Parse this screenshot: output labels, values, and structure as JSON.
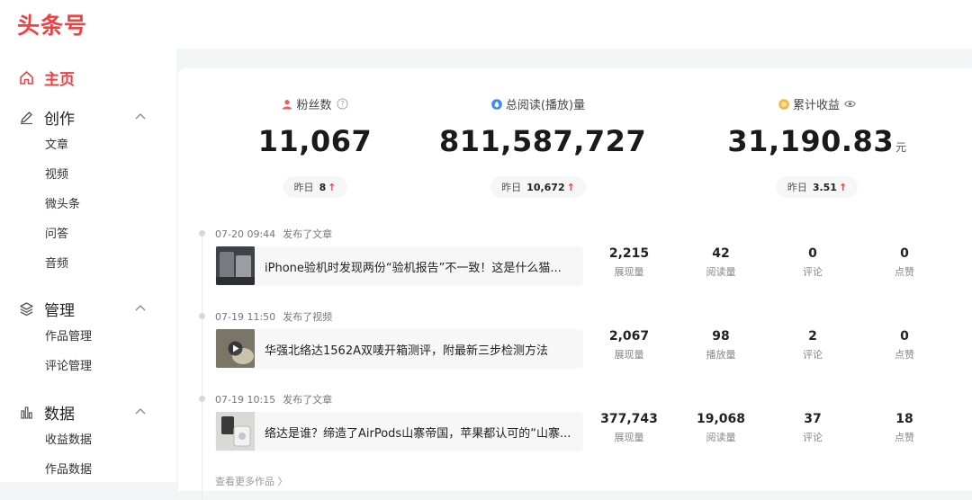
{
  "brand": {
    "logo_text": "头条号",
    "accent": "#f04142"
  },
  "sidebar": {
    "home": {
      "label": "主页",
      "icon": "home-icon"
    },
    "groups": [
      {
        "label": "创作",
        "icon": "pen-icon",
        "items": [
          "文章",
          "视频",
          "微头条",
          "问答",
          "音频"
        ]
      },
      {
        "label": "管理",
        "icon": "layers-icon",
        "items": [
          "作品管理",
          "评论管理"
        ]
      },
      {
        "label": "数据",
        "icon": "bar-chart-icon",
        "items": [
          "收益数据",
          "作品数据"
        ]
      }
    ]
  },
  "stats": [
    {
      "label": "粉丝数",
      "icon": "user-icon",
      "suffix_icon": "help-icon",
      "value": "11,067",
      "unit": "",
      "yesterday_label": "昨日",
      "yesterday_value": "8",
      "trend": "↑"
    },
    {
      "label": "总阅读(播放)量",
      "icon": "drop-icon",
      "suffix_icon": "",
      "value": "811,587,727",
      "unit": "",
      "yesterday_label": "昨日",
      "yesterday_value": "10,672",
      "trend": "↑"
    },
    {
      "label": "累计收益",
      "icon": "coin-icon",
      "suffix_icon": "eye-icon",
      "value": "31,190.83",
      "unit": "元",
      "yesterday_label": "昨日",
      "yesterday_value": "3.51",
      "trend": "↑"
    }
  ],
  "feed": [
    {
      "time": "07-20 09:44",
      "kind": "发布了文章",
      "title": "iPhone验机时发现两份“验机报告”不一致！这是什么猫...",
      "metrics": [
        {
          "value": "2,215",
          "label": "展现量"
        },
        {
          "value": "42",
          "label": "阅读量"
        },
        {
          "value": "0",
          "label": "评论"
        },
        {
          "value": "0",
          "label": "点赞"
        }
      ]
    },
    {
      "time": "07-19 11:50",
      "kind": "发布了视频",
      "title": "华强北络达1562A双唛开箱测评，附最新三步检测方法",
      "metrics": [
        {
          "value": "2,067",
          "label": "展现量"
        },
        {
          "value": "98",
          "label": "播放量"
        },
        {
          "value": "2",
          "label": "评论"
        },
        {
          "value": "0",
          "label": "点赞"
        }
      ]
    },
    {
      "time": "07-19 10:15",
      "kind": "发布了文章",
      "title": "络达是谁？缔造了AirPods山寨帝国，苹果都认可的“山寨...",
      "metrics": [
        {
          "value": "377,743",
          "label": "展现量"
        },
        {
          "value": "19,068",
          "label": "阅读量"
        },
        {
          "value": "37",
          "label": "评论"
        },
        {
          "value": "18",
          "label": "点赞"
        }
      ]
    }
  ],
  "more_link": "查看更多作品 〉"
}
